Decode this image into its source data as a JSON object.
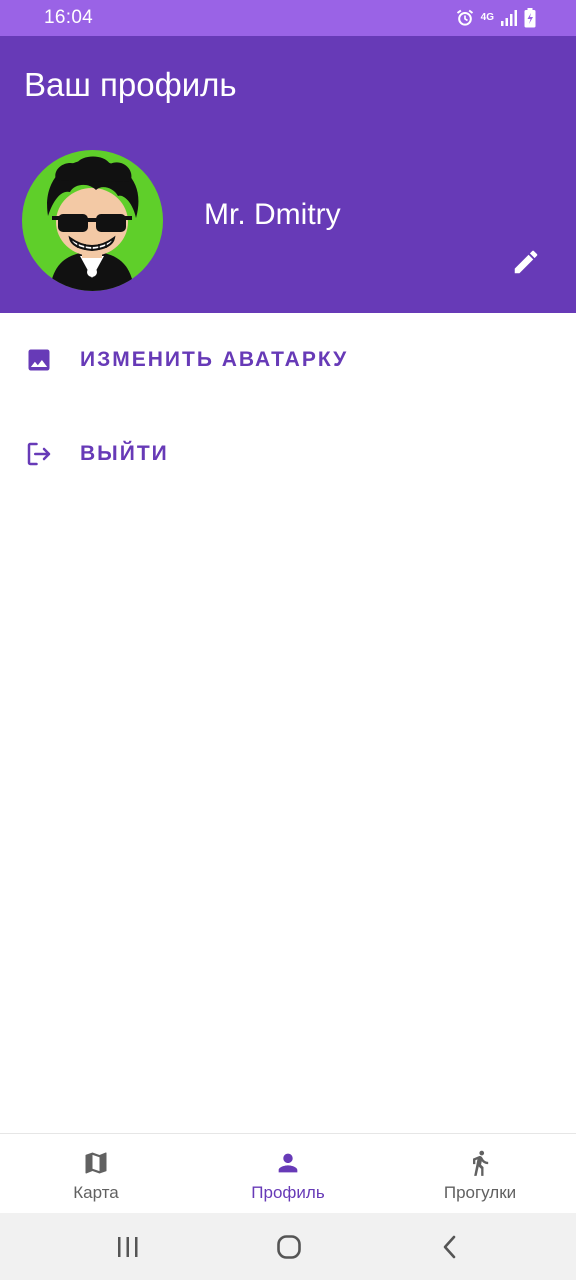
{
  "status_bar": {
    "time": "16:04",
    "network": "4G",
    "bg_color": "#9a63e6"
  },
  "header": {
    "title": "Ваш профиль",
    "bg_color": "#673ab7"
  },
  "profile": {
    "name": "Mr. Dmitry",
    "avatar_bg": "#5fcf2a",
    "avatar_icon": "cartoon-avatar",
    "edit_icon": "pencil-icon"
  },
  "actions": [
    {
      "label": "ИЗМЕНИТЬ АВАТАРКУ",
      "icon": "image-icon"
    },
    {
      "label": "ВЫЙТИ",
      "icon": "logout-icon"
    }
  ],
  "bottom_nav": {
    "items": [
      {
        "label": "Карта",
        "icon": "map-icon",
        "active": false
      },
      {
        "label": "Профиль",
        "icon": "person-icon",
        "active": true
      },
      {
        "label": "Прогулки",
        "icon": "walk-icon",
        "active": false
      }
    ],
    "active_color": "#673ab7",
    "inactive_color": "#616161"
  },
  "system_nav": {
    "buttons": [
      "recents-icon",
      "home-icon",
      "back-icon"
    ]
  }
}
